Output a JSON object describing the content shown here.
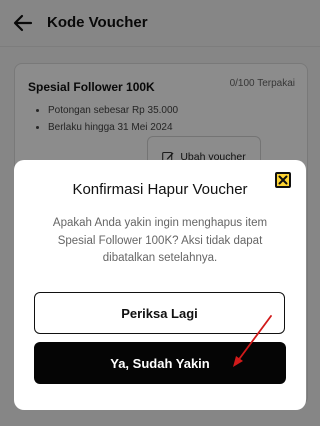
{
  "appbar": {
    "title": "Kode Voucher"
  },
  "voucher_card": {
    "title": "Spesial Follower 100K",
    "quota": "0/100 Terpakai",
    "details": [
      "Potongan sebesar Rp 35.000",
      "Berlaku hingga 31 Mei 2024"
    ],
    "edit_label": "Ubah voucher"
  },
  "modal": {
    "title": "Konfirmasi Hapur Voucher",
    "message": "Apakah Anda yakin ingin menghapus item Spesial Follower 100K? Aksi tidak dapat dibatalkan setelahnya.",
    "review_label": "Periksa Lagi",
    "confirm_label": "Ya, Sudah Yakin"
  },
  "colors": {
    "close_button_bg": "#ffd633",
    "primary_button": "#050505",
    "annotation_arrow": "#d11a1a"
  },
  "icons": {
    "back": "arrow-left-icon",
    "edit": "edit-icon",
    "close": "close-icon",
    "annotation": "red-pointer-arrow"
  }
}
